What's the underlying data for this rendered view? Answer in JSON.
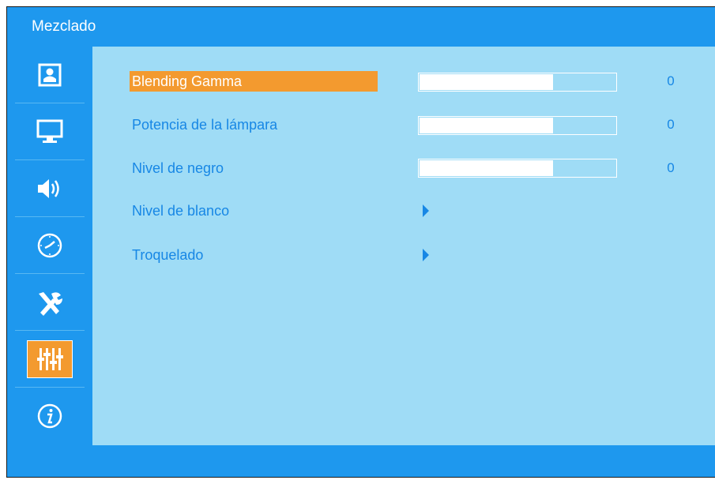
{
  "title": "Mezclado",
  "sidebar": {
    "items": [
      {
        "icon": "picture-icon",
        "label": ""
      },
      {
        "icon": "display-icon",
        "label": ""
      },
      {
        "icon": "speaker-icon",
        "label": ""
      },
      {
        "icon": "clock-icon",
        "label": ""
      },
      {
        "icon": "tools-icon",
        "label": ""
      },
      {
        "icon": "equalizer-icon",
        "label": "",
        "active": true
      },
      {
        "icon": "info-icon",
        "label": ""
      }
    ]
  },
  "menu": {
    "items": [
      {
        "label": "Blending Gamma",
        "value": "0",
        "level": 0.68,
        "type": "slider",
        "selected": true
      },
      {
        "label": "Potencia de la lámpara",
        "value": "0",
        "level": 0.68,
        "type": "slider"
      },
      {
        "label": "Nivel de negro",
        "value": "0",
        "level": 0.68,
        "type": "slider"
      },
      {
        "label": "Nivel de blanco",
        "type": "submenu"
      },
      {
        "label": "Troquelado",
        "type": "submenu"
      }
    ]
  },
  "colors": {
    "bar_blue": "#1e98ee",
    "panel_light_blue": "#9fdcf6",
    "text_blue": "#1787e5",
    "highlight_orange": "#f39a2f"
  }
}
